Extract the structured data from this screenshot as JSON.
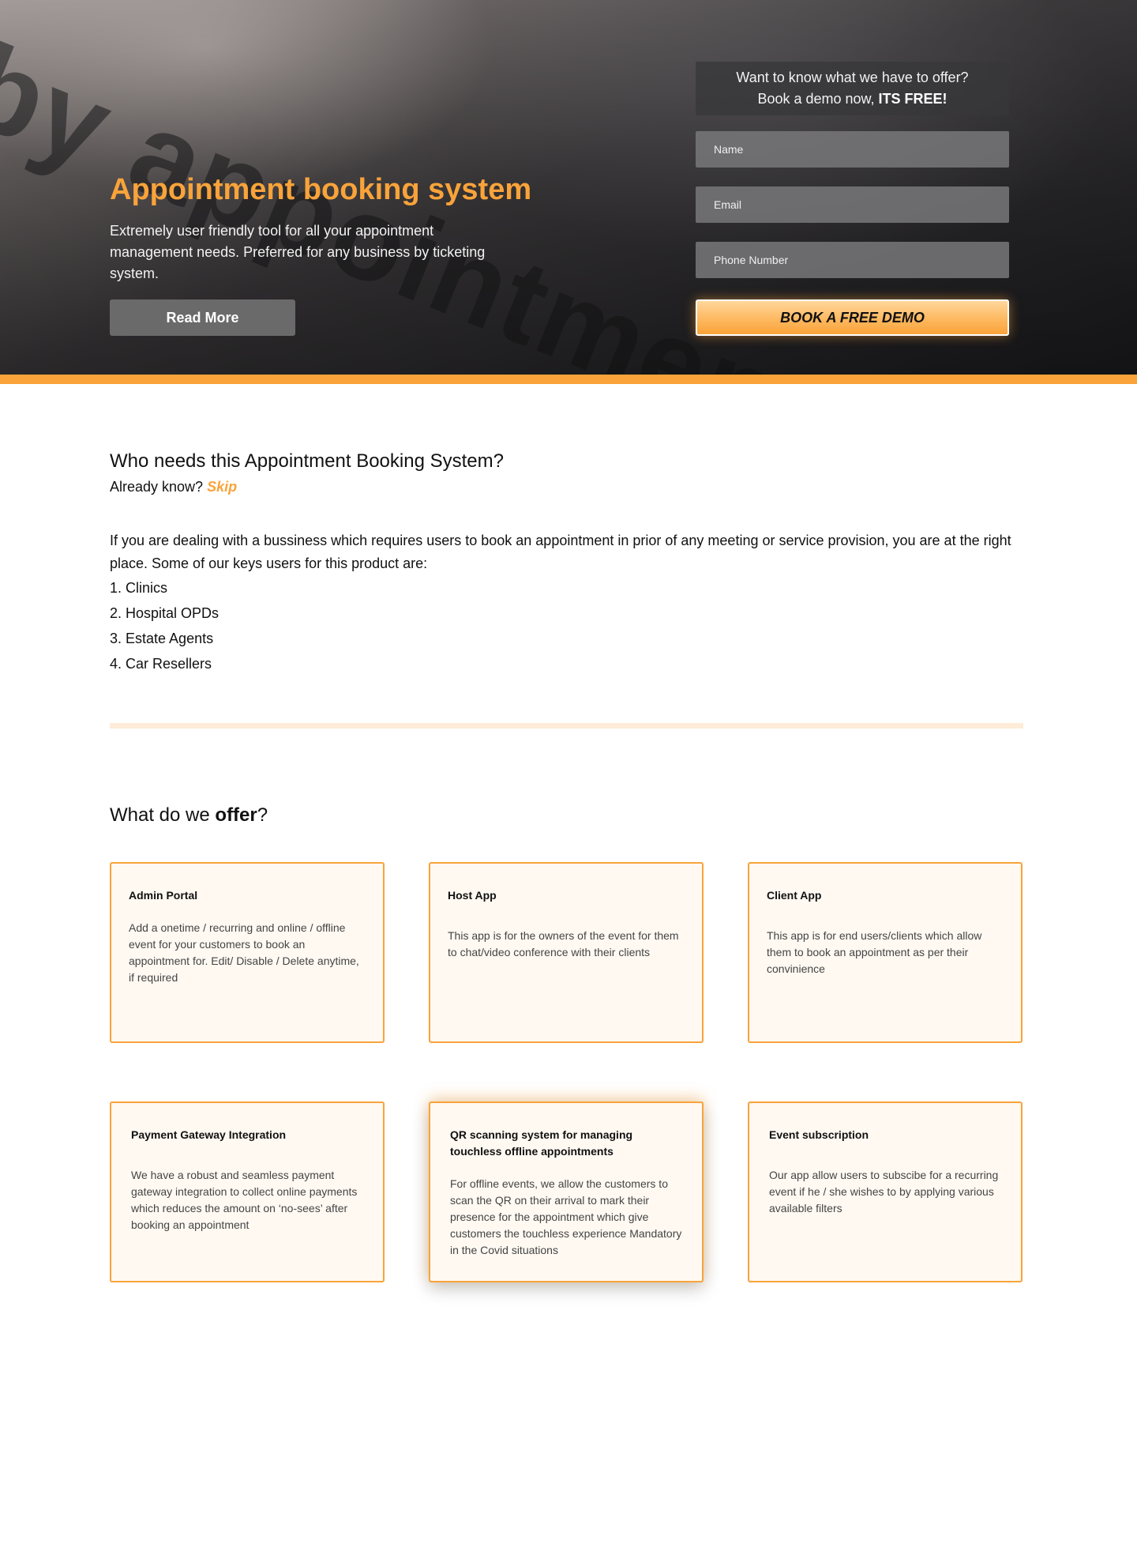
{
  "hero": {
    "background_text": "by appointment",
    "title": "Appointment booking system",
    "description": "Extremely user friendly tool for all your appointment management needs. Preferred for any business by ticketing system.",
    "read_more_label": "Read More"
  },
  "demo_form": {
    "heading_line1": "Want to know what we have to offer?",
    "heading_line2_prefix": "Book a demo now, ",
    "heading_line2_bold": "ITS FREE!",
    "name_placeholder": "Name",
    "email_placeholder": "Email",
    "phone_placeholder": "Phone Number",
    "submit_label": "BOOK A FREE DEMO"
  },
  "who_needs": {
    "title": "Who needs this Appointment Booking System?",
    "already_know": "Already know? ",
    "skip_label": "Skip",
    "text": "If you are dealing with a bussiness which requires users to book an appointment in prior of any meeting or service provision, you are at the right place. Some of our keys users for this product are:",
    "users": [
      "1. Clinics",
      "2. Hospital OPDs",
      "3. Estate Agents",
      "4. Car Resellers"
    ]
  },
  "offer": {
    "title_prefix": "What do we ",
    "title_bold": "offer",
    "title_suffix": "?",
    "cards": [
      {
        "title": "Admin Portal",
        "body": "Add a onetime / recurring and online / offline event for your customers to book an appointment for. Edit/ Disable / Delete anytime, if required"
      },
      {
        "title": "Host App",
        "body": "This app is for the owners of the event for them to chat/video conference with their clients"
      },
      {
        "title": "Client App",
        "body": "This app is for end users/clients which allow them to book an appointment as per their convinience"
      },
      {
        "title": "Payment Gateway Integration",
        "body": "We have a robust and seamless payment gateway integration to collect online payments which reduces the amount on ‘no-sees’ after booking an appointment"
      },
      {
        "title": "QR scanning system for managing touchless offline appointments",
        "body": "For offline events, we allow the customers to scan the QR on their arrival to mark their presence for the appointment which give customers the touchless experience Mandatory in the Covid situations"
      },
      {
        "title": "Event subscription",
        "body": "Our app allow users to subscibe for a recurring event if he / she wishes to by applying various available filters"
      }
    ]
  },
  "colors": {
    "accent": "#f9a33a",
    "card_background": "#fff9f2",
    "divider": "#feecd8"
  }
}
